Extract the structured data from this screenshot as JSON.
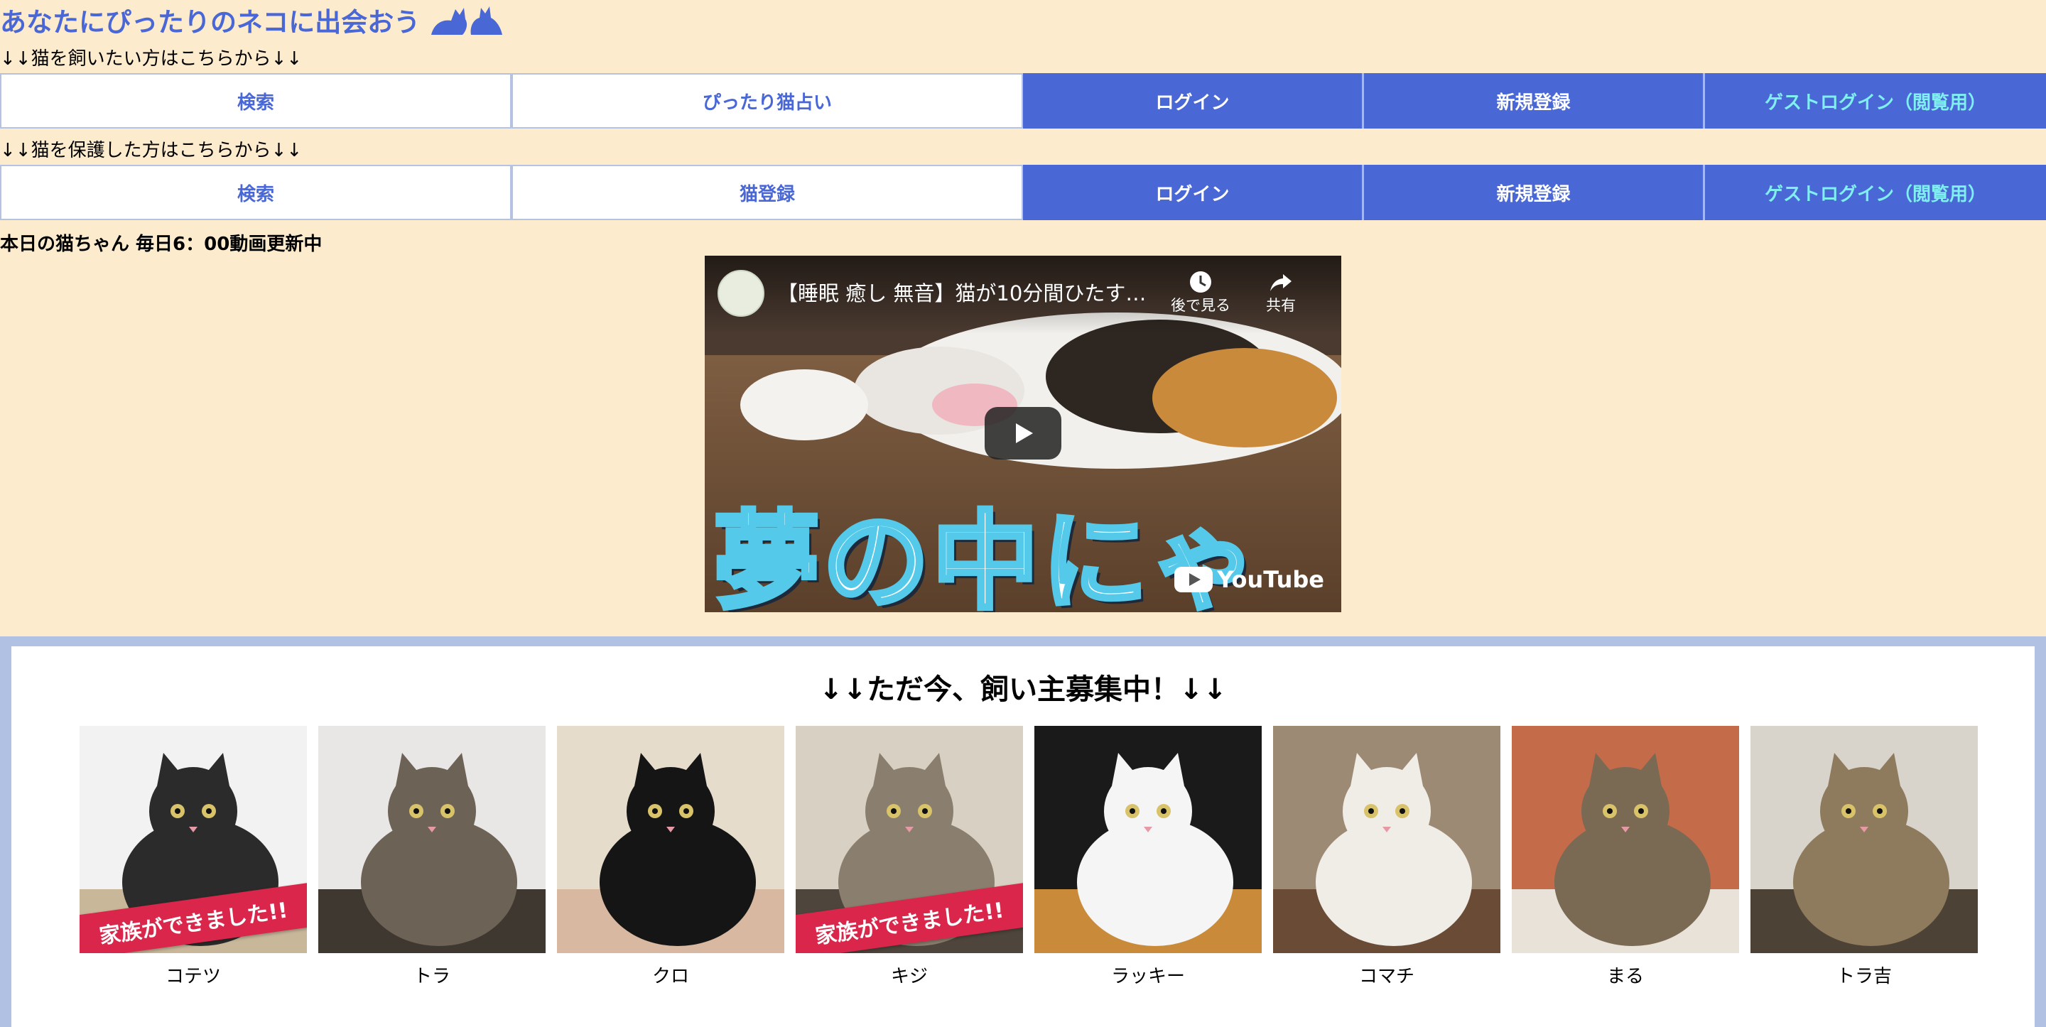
{
  "header": {
    "title": "あなたにぴったりのネコに出会おう"
  },
  "owners": {
    "label": "↓↓猫を飼いたい方はこちらから↓↓",
    "buttons": [
      "検索",
      "ぴったり猫占い",
      "ログイン",
      "新規登録",
      "ゲストログイン（閲覧用）"
    ]
  },
  "protectors": {
    "label": "↓↓猫を保護した方はこちらから↓↓",
    "buttons": [
      "検索",
      "猫登録",
      "ログイン",
      "新規登録",
      "ゲストログイン（閲覧用）"
    ]
  },
  "today": {
    "label": "本日の猫ちゃん 毎日6：00動画更新中"
  },
  "video": {
    "title": "【睡眠 癒し 無音】猫が10分間ひたすら...",
    "watch_later": "後で見る",
    "share": "共有",
    "thumbnail_text": "夢の中にゃ",
    "platform": "YouTube"
  },
  "recruit": {
    "title": "↓↓ただ今、飼い主募集中！↓↓",
    "adopted_label": "家族ができました!!",
    "cats": [
      {
        "name": "コテツ",
        "adopted": true,
        "colors": [
          "#2b2b2b",
          "#f2f2f2",
          "#c9b79a"
        ]
      },
      {
        "name": "トラ",
        "adopted": false,
        "colors": [
          "#6d6256",
          "#e9e6e6",
          "#3f3830"
        ]
      },
      {
        "name": "クロ",
        "adopted": false,
        "colors": [
          "#151515",
          "#e6dccb",
          "#d8b8a0"
        ]
      },
      {
        "name": "キジ",
        "adopted": true,
        "colors": [
          "#8a7e6e",
          "#d8d0c2",
          "#4e463c"
        ]
      },
      {
        "name": "ラッキー",
        "adopted": false,
        "colors": [
          "#f5f5f5",
          "#1a1a1a",
          "#c98b3a"
        ]
      },
      {
        "name": "コマチ",
        "adopted": false,
        "colors": [
          "#f0ece6",
          "#9d8a74",
          "#6a4c36"
        ]
      },
      {
        "name": "まる",
        "adopted": false,
        "colors": [
          "#7a6a54",
          "#c46b4a",
          "#e8e2d8"
        ]
      },
      {
        "name": "トラ吉",
        "adopted": false,
        "colors": [
          "#8e7a5c",
          "#d8d4cc",
          "#4d4236"
        ]
      }
    ]
  },
  "colors": {
    "accent": "#4a67d6",
    "background": "#fdebcd",
    "guest_text": "#7ff0ef",
    "panel_border": "#b0c1e3",
    "ribbon": "#d9264a"
  }
}
